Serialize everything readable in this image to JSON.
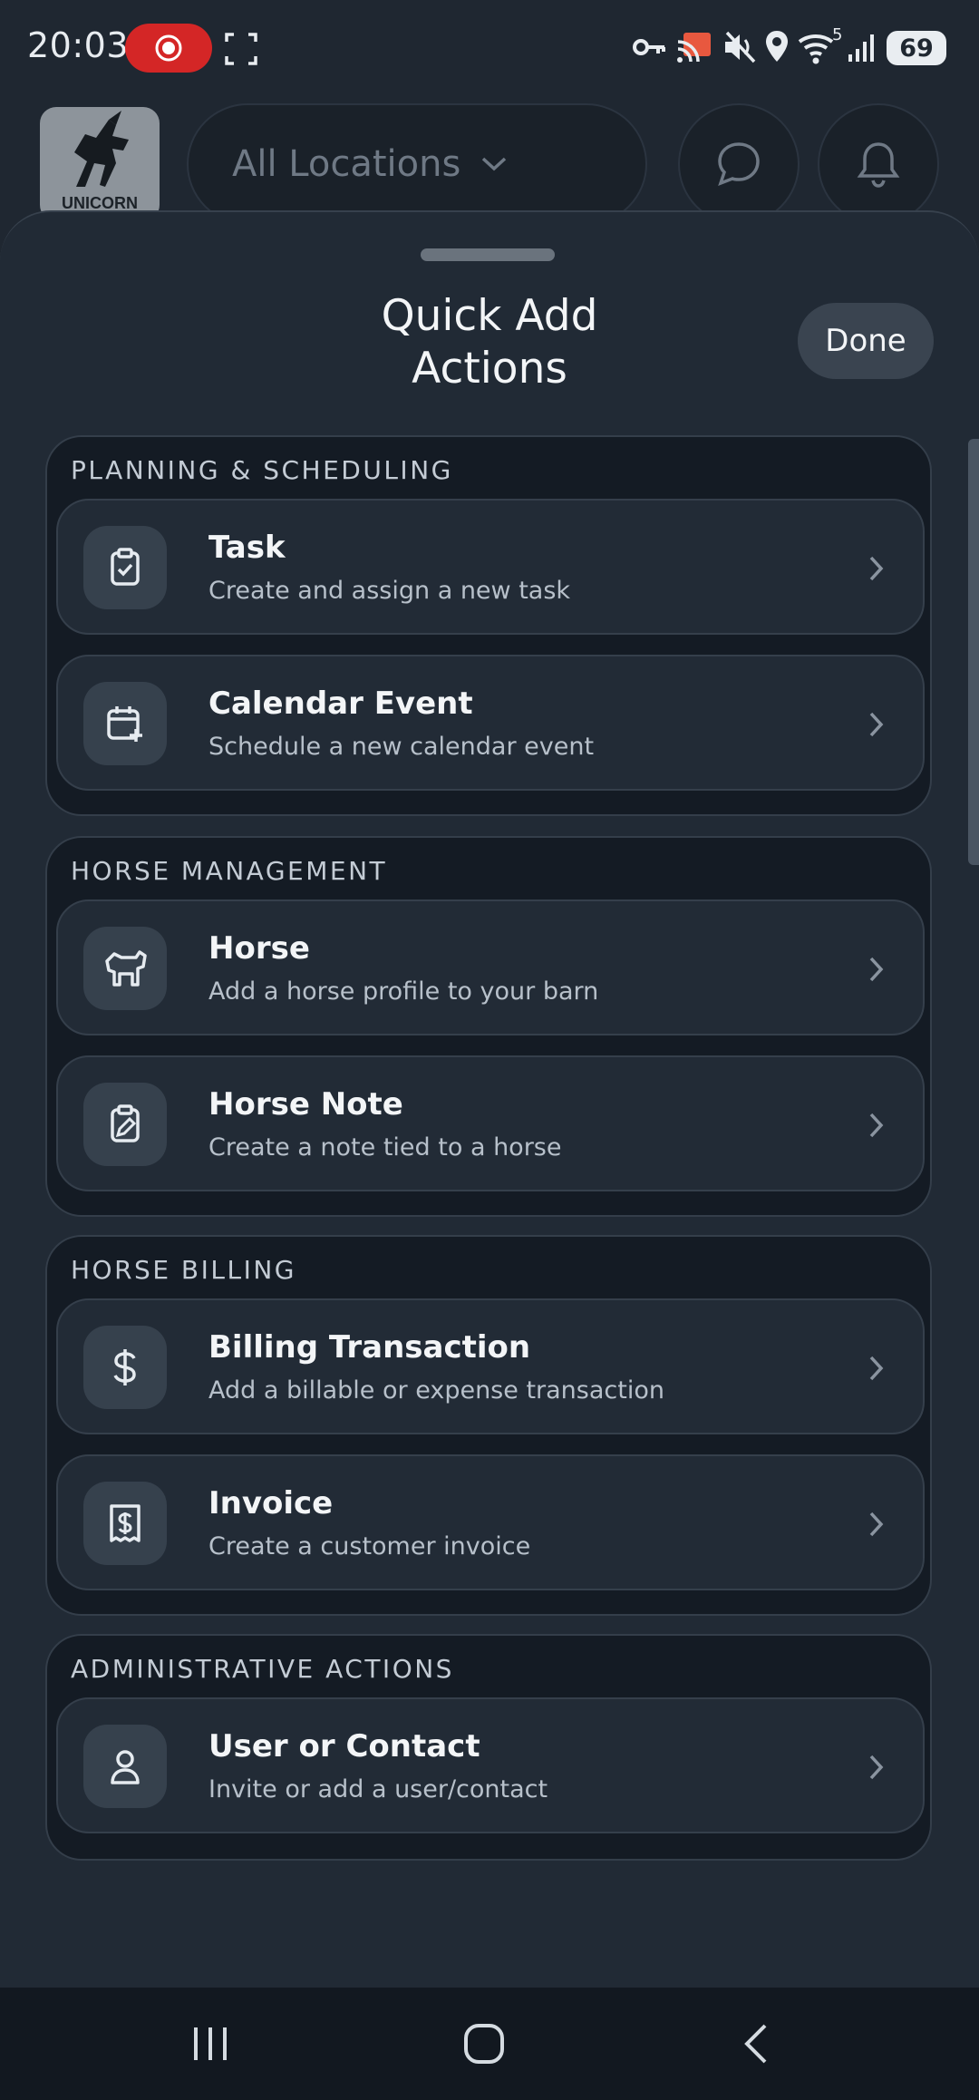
{
  "status_bar": {
    "time": "20:03",
    "battery": "69",
    "signal_superscript": "5"
  },
  "header": {
    "logo_text": "UNICORN",
    "location_label": "All Locations"
  },
  "sheet": {
    "title_line1": "Quick Add",
    "title_line2": "Actions",
    "done_label": "Done"
  },
  "sections": [
    {
      "title": "PLANNING & SCHEDULING",
      "items": [
        {
          "icon": "clipboard-check-icon",
          "title": "Task",
          "subtitle": "Create and assign a new task"
        },
        {
          "icon": "calendar-plus-icon",
          "title": "Calendar Event",
          "subtitle": "Schedule a new calendar event"
        }
      ]
    },
    {
      "title": "HORSE MANAGEMENT",
      "items": [
        {
          "icon": "horse-icon",
          "title": "Horse",
          "subtitle": "Add a horse profile to your barn"
        },
        {
          "icon": "clipboard-edit-icon",
          "title": "Horse Note",
          "subtitle": "Create a note tied to a horse"
        }
      ]
    },
    {
      "title": "HORSE BILLING",
      "items": [
        {
          "icon": "dollar-icon",
          "title": "Billing Transaction",
          "subtitle": "Add a billable or expense transaction"
        },
        {
          "icon": "receipt-icon",
          "title": "Invoice",
          "subtitle": "Create a customer invoice"
        }
      ]
    },
    {
      "title": "ADMINISTRATIVE ACTIONS",
      "items": [
        {
          "icon": "user-icon",
          "title": "User or Contact",
          "subtitle": "Invite or add a user/contact"
        }
      ]
    }
  ],
  "colors": {
    "background": "#1f2731",
    "sheet": "#212a35",
    "section": "#141b24",
    "card": "#222b36",
    "record_indicator": "#d42626"
  }
}
